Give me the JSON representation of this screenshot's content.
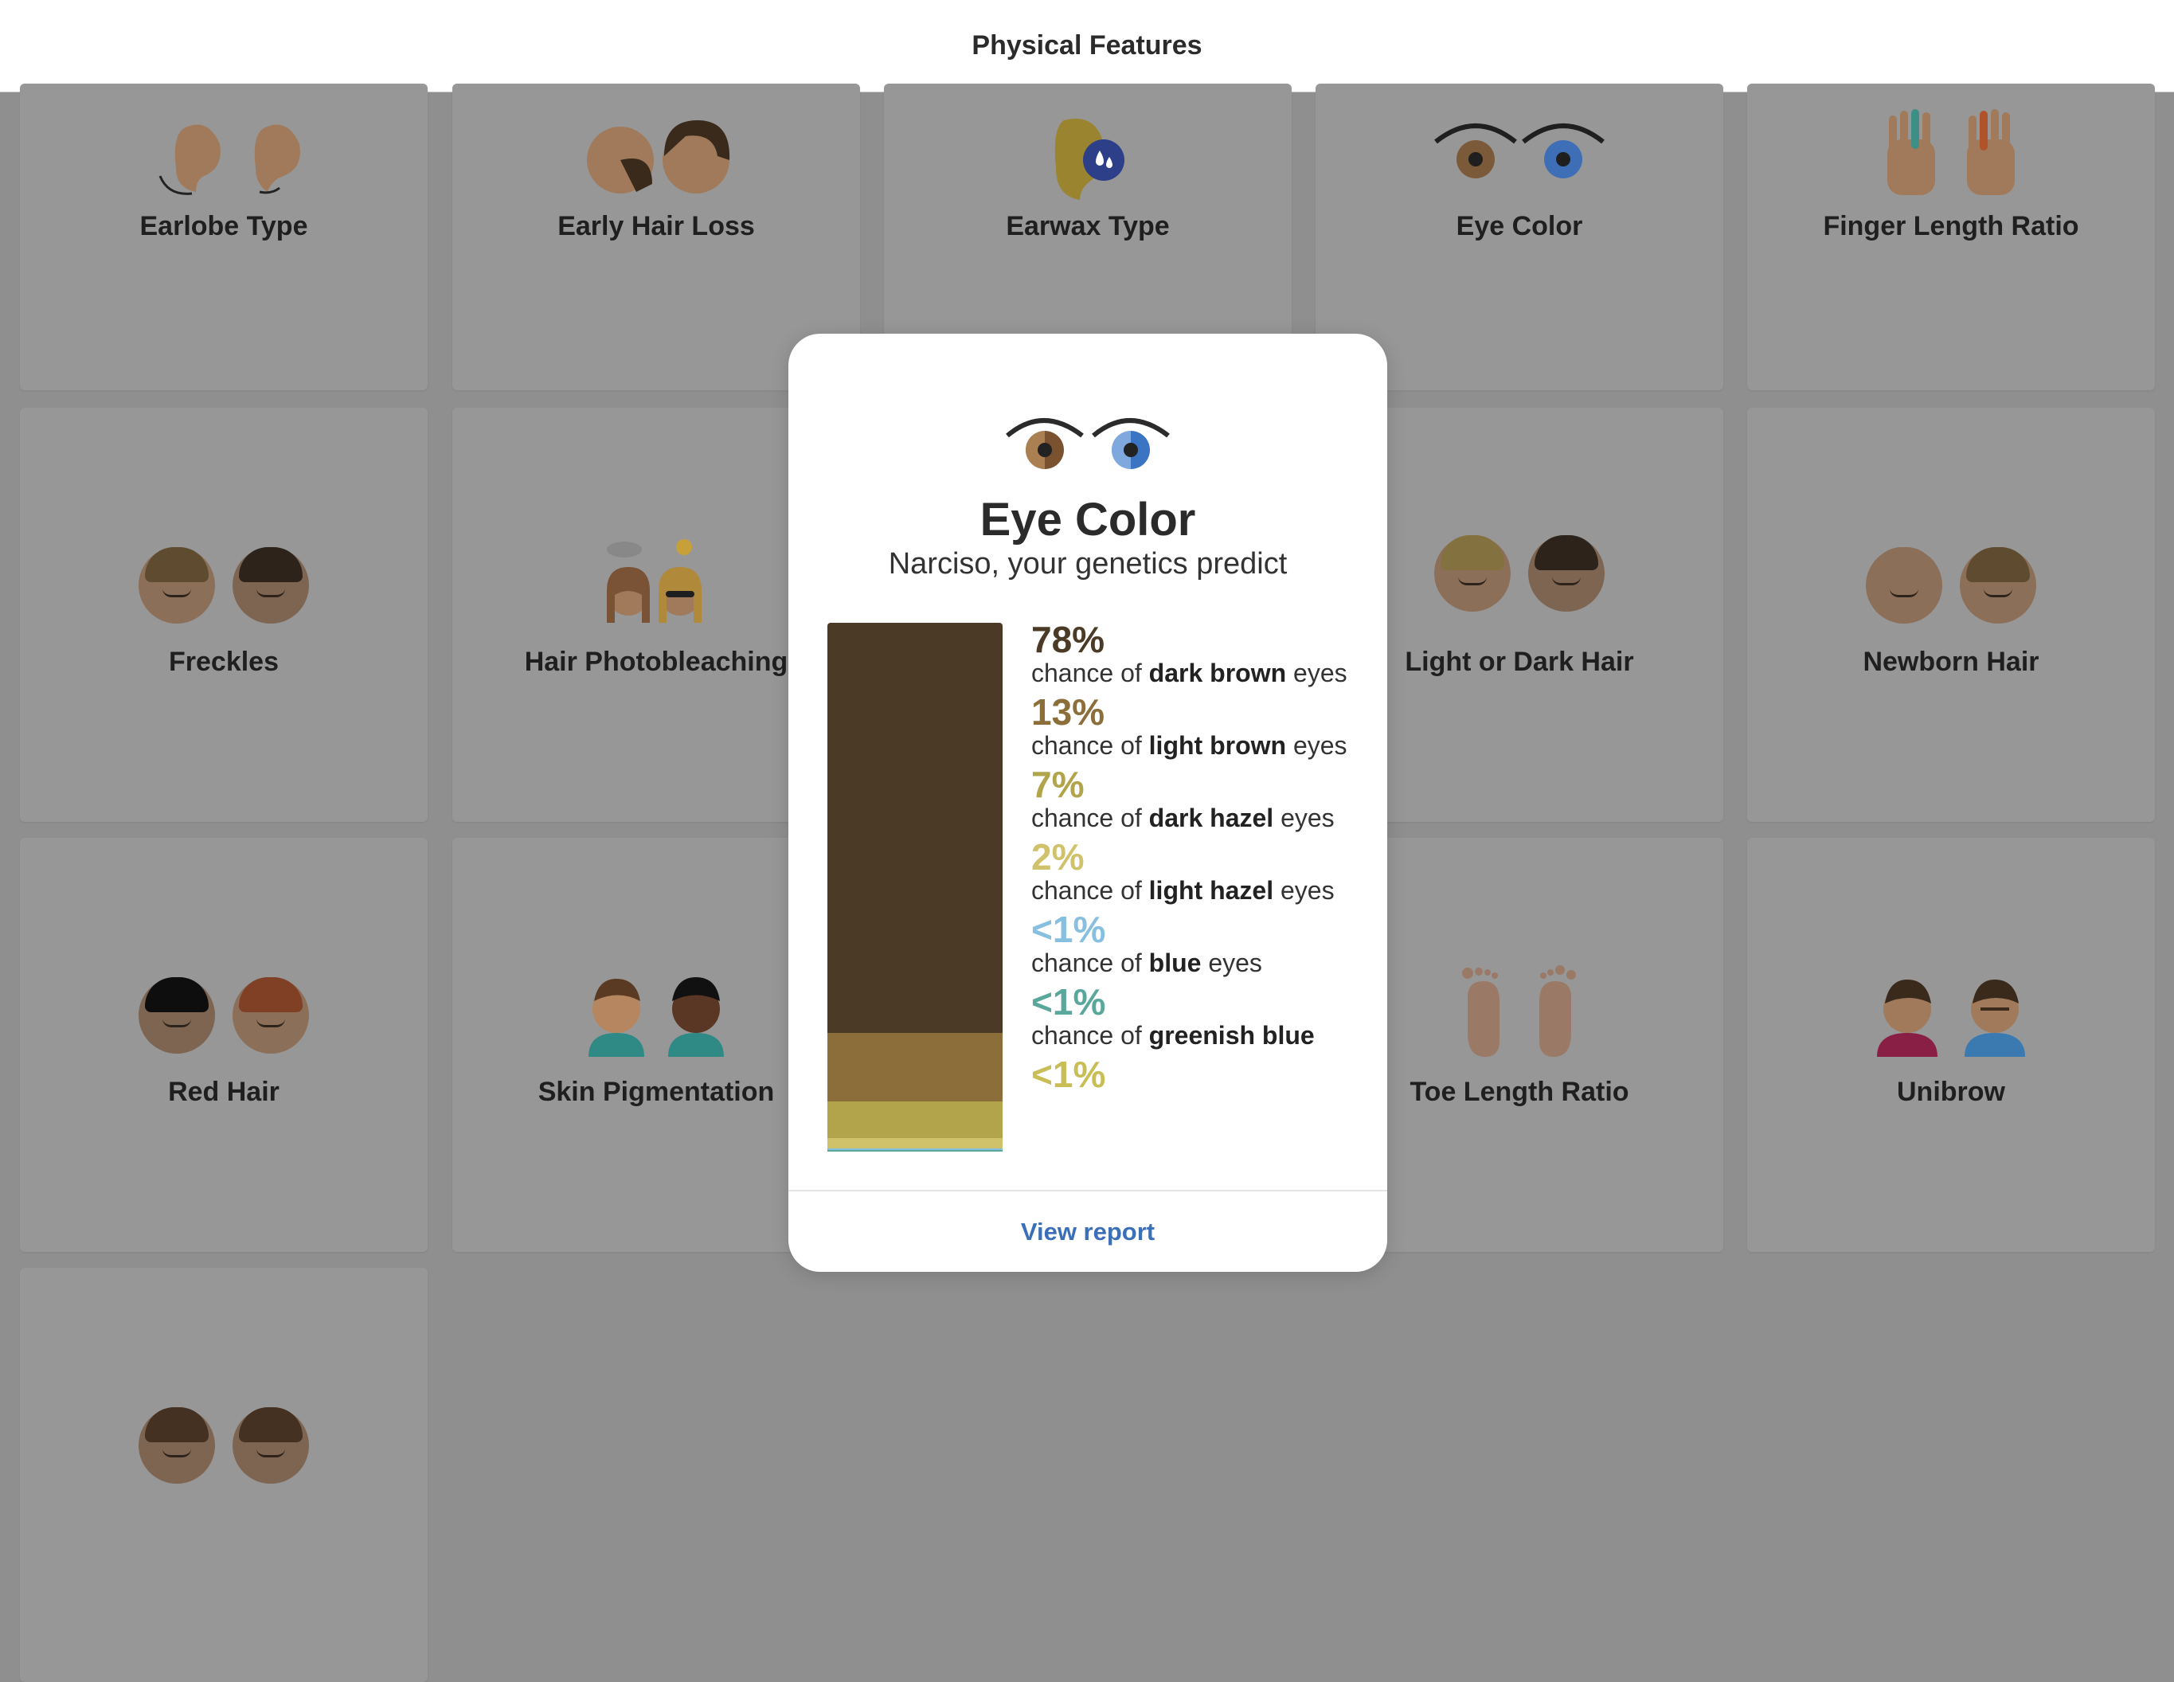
{
  "header": {
    "title": "Physical Features"
  },
  "grid": {
    "cards": [
      {
        "label": "Earlobe Type",
        "icon": "earlobe-icon"
      },
      {
        "label": "Early Hair Loss",
        "icon": "hair-loss-icon"
      },
      {
        "label": "Earwax Type",
        "icon": "earwax-icon"
      },
      {
        "label": "Eye Color",
        "icon": "eye-color-icon"
      },
      {
        "label": "Finger Length Ratio",
        "icon": "hand-icon"
      },
      {
        "label": "Freckles",
        "icon": "freckles-faces-icon"
      },
      {
        "label": "Hair Photobleaching",
        "icon": "sun-cloud-faces-icon"
      },
      {
        "label": "",
        "icon": ""
      },
      {
        "label": "Light or Dark Hair",
        "icon": "light-dark-hair-faces-icon"
      },
      {
        "label": "Newborn Hair",
        "icon": "baby-faces-icon"
      },
      {
        "label": "Red Hair",
        "icon": "red-hair-faces-icon"
      },
      {
        "label": "Skin Pigmentation",
        "icon": "skin-faces-icon"
      },
      {
        "label": "",
        "icon": ""
      },
      {
        "label": "Toe Length Ratio",
        "icon": "feet-icon"
      },
      {
        "label": "Unibrow",
        "icon": "unibrow-faces-icon"
      },
      {
        "label": "",
        "icon": "faces-icon"
      }
    ]
  },
  "modal": {
    "icon": "eye-color-icon",
    "title": "Eye Color",
    "subtitle": "Narciso, your genetics predict",
    "results": [
      {
        "pct": "78%",
        "prefix": "chance of ",
        "trait": "dark brown",
        "suffix": " eyes",
        "value": 78,
        "color": "#4b3a26"
      },
      {
        "pct": "13%",
        "prefix": "chance of ",
        "trait": "light brown",
        "suffix": " eyes",
        "value": 13,
        "color": "#8b6e3a"
      },
      {
        "pct": "7%",
        "prefix": "chance of ",
        "trait": "dark hazel",
        "suffix": " eyes",
        "value": 7,
        "color": "#b2a44a"
      },
      {
        "pct": "2%",
        "prefix": "chance of ",
        "trait": "light hazel",
        "suffix": " eyes",
        "value": 2,
        "color": "#cfc26a"
      },
      {
        "pct": "<1%",
        "prefix": "chance of ",
        "trait": "blue",
        "suffix": " eyes",
        "value": 0.3,
        "color": "#86bfe0"
      },
      {
        "pct": "<1%",
        "prefix": "chance of ",
        "trait": "greenish blue",
        "suffix": "",
        "value": 0.3,
        "color": "#5aa79c"
      },
      {
        "pct": "<1%",
        "prefix": "",
        "trait": "",
        "suffix": "",
        "value": 0,
        "color": "#c9bd55"
      }
    ],
    "action_label": "View report",
    "link_color": "#3b6fb8"
  }
}
